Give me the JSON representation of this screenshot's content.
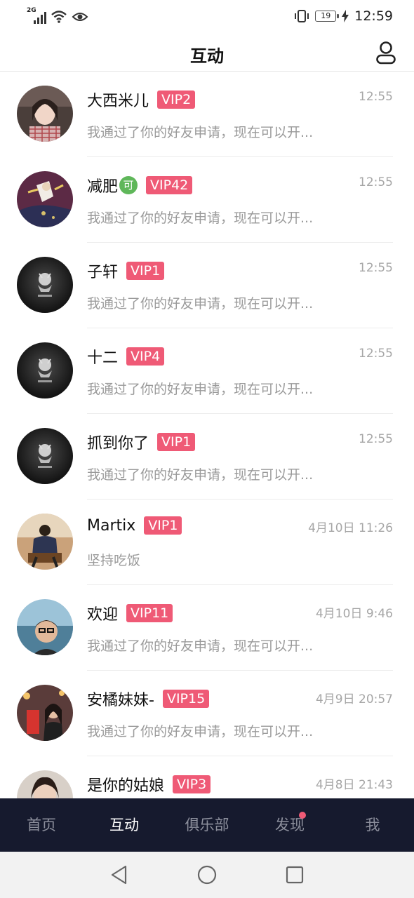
{
  "status_bar": {
    "network": "2G",
    "battery": "19",
    "time": "12:59",
    "icons": [
      "signal-icon",
      "wifi-icon",
      "eye-icon",
      "vibrate-icon",
      "battery-icon",
      "charging-icon"
    ]
  },
  "header": {
    "title": "互动",
    "profile_icon": "user-icon"
  },
  "messages": [
    {
      "name": "大西米儿",
      "vip": "VIP2",
      "time": "12:55",
      "text": "我通过了你的好友申请，现在可以开...",
      "avatar": "photo-woman"
    },
    {
      "name": "减肥",
      "badge": "可",
      "vip": "VIP42",
      "time": "12:55",
      "text": "我通过了你的好友申请，现在可以开...",
      "avatar": "illustration"
    },
    {
      "name": "子轩",
      "vip": "VIP1",
      "time": "12:55",
      "text": "我通过了你的好友申请，现在可以开...",
      "avatar": "dark-logo"
    },
    {
      "name": "十二",
      "vip": "VIP4",
      "time": "12:55",
      "text": "我通过了你的好友申请，现在可以开...",
      "avatar": "dark-logo"
    },
    {
      "name": "抓到你了",
      "vip": "VIP1",
      "time": "12:55",
      "text": "我通过了你的好友申请，现在可以开...",
      "avatar": "dark-logo"
    },
    {
      "name": "Martix",
      "vip": "VIP1",
      "time": "4月10日 11:26",
      "text": "坚持吃饭",
      "avatar": "photo-man-chair"
    },
    {
      "name": "欢迎",
      "vip": "VIP11",
      "time": "4月10日 9:46",
      "text": "我通过了你的好友申请，现在可以开...",
      "avatar": "photo-man-sea"
    },
    {
      "name": "安橘妹妹-",
      "vip": "VIP15",
      "time": "4月9日 20:57",
      "text": "我通过了你的好友申请，现在可以开...",
      "avatar": "photo-woman-street"
    },
    {
      "name": "是你的姑娘",
      "vip": "VIP3",
      "time": "4月8日 21:43",
      "text": "",
      "avatar": "photo-woman-2"
    }
  ],
  "tabs": [
    {
      "label": "首页",
      "active": false
    },
    {
      "label": "互动",
      "active": true
    },
    {
      "label": "俱乐部",
      "active": false
    },
    {
      "label": "发现",
      "active": false,
      "dot": true
    },
    {
      "label": "我",
      "active": false
    }
  ],
  "colors": {
    "vip": "#ef5a76",
    "tabbar": "#161a2e",
    "badge": "#5fb75a"
  }
}
